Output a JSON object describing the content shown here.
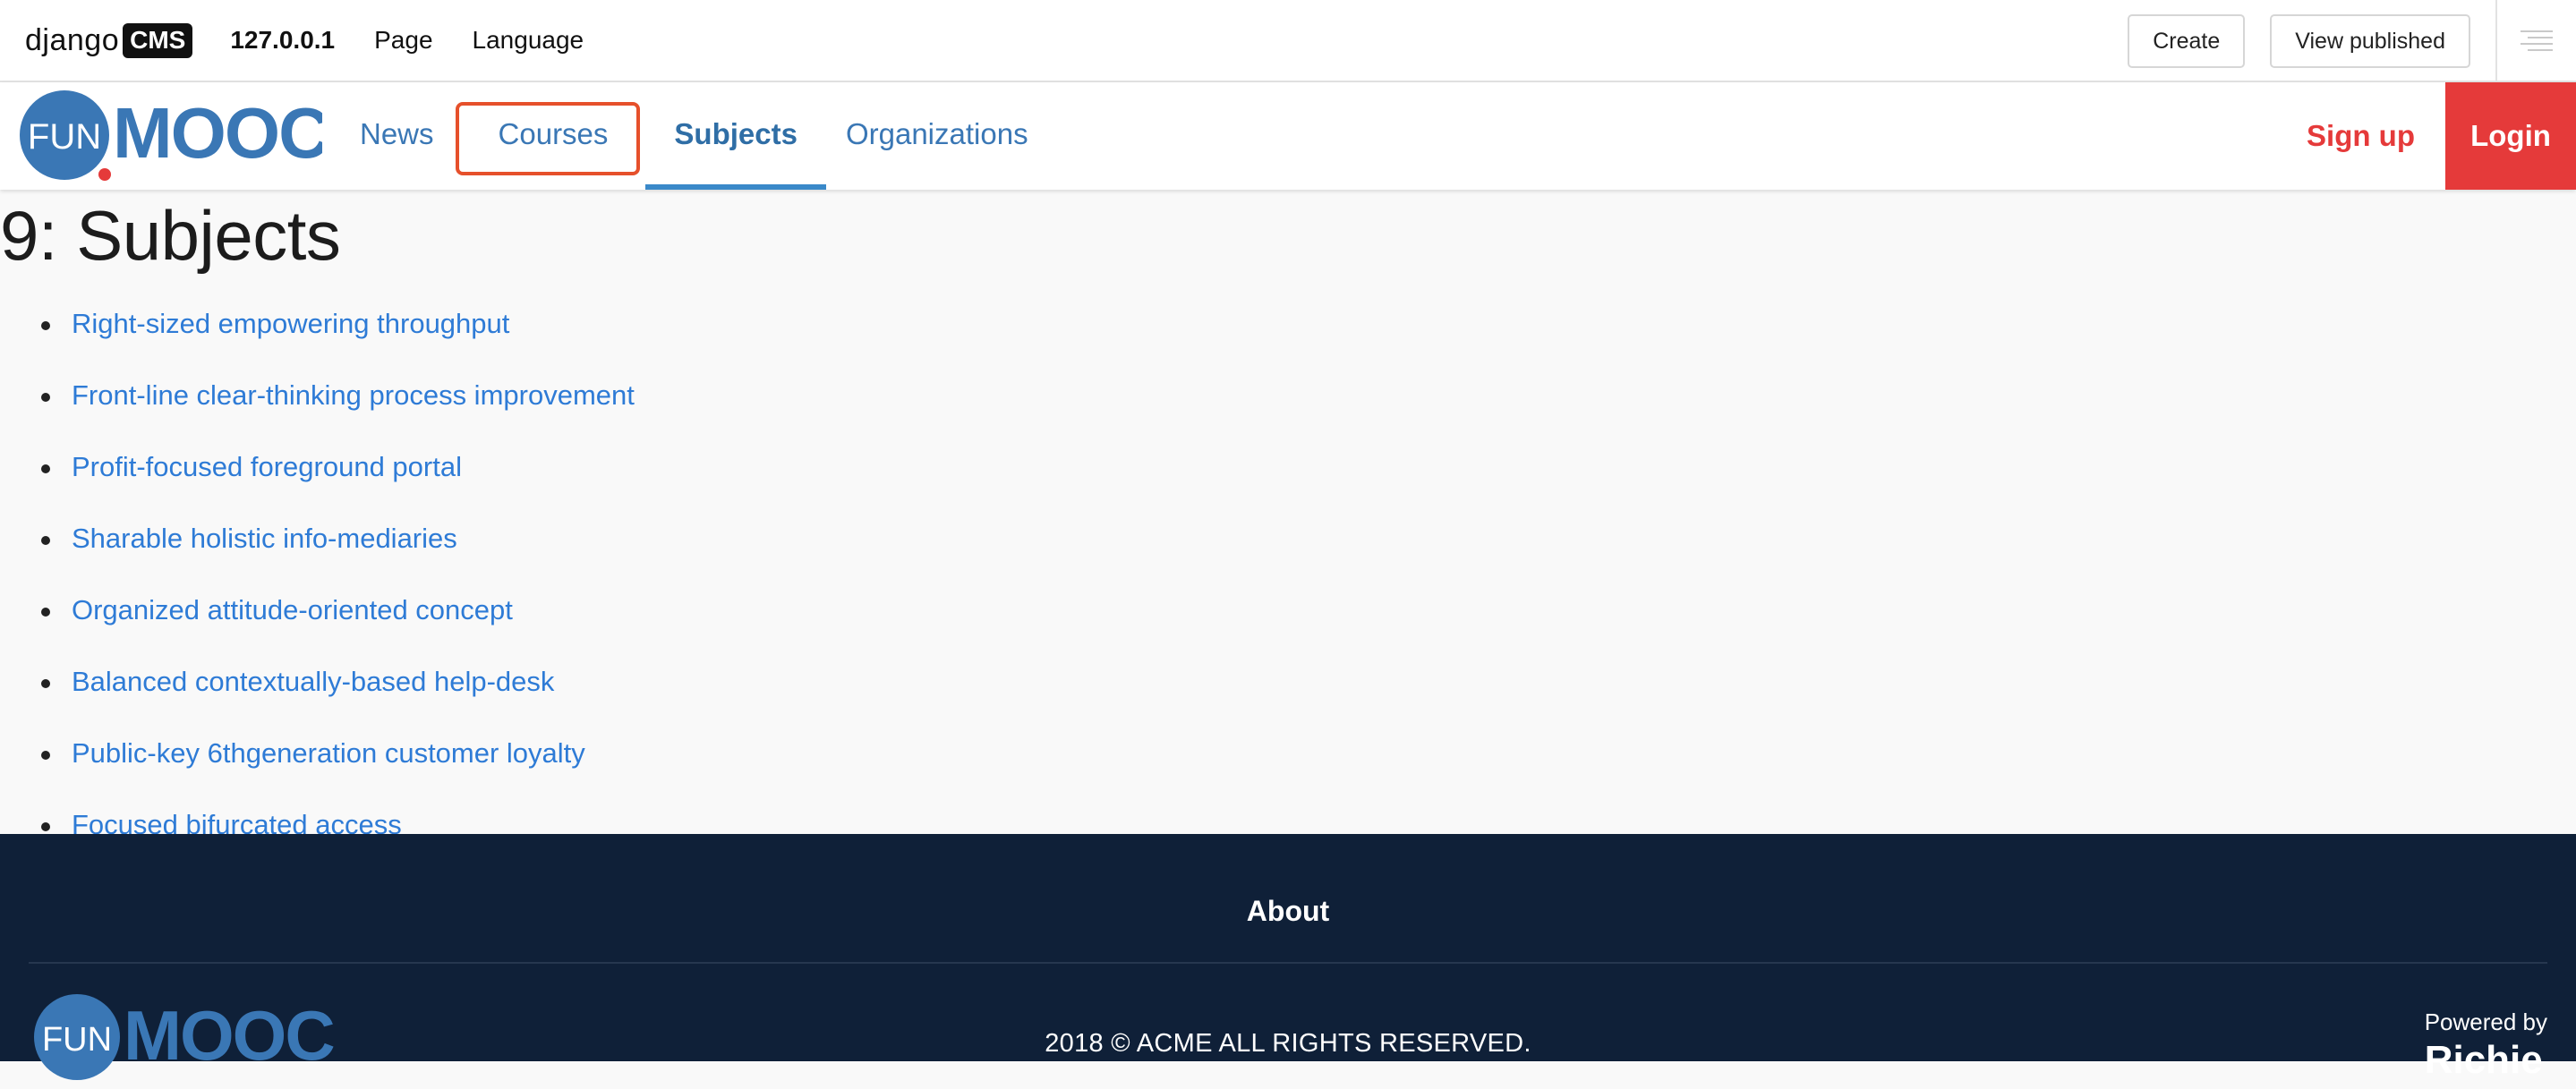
{
  "cms_toolbar": {
    "logo_text": "django",
    "logo_badge": "CMS",
    "menu": [
      {
        "label": "127.0.0.1"
      },
      {
        "label": "Page"
      },
      {
        "label": "Language"
      }
    ],
    "create_label": "Create",
    "view_published_label": "View published",
    "side_toggle_icon": "list-lines-icon"
  },
  "header": {
    "brand": {
      "fun": "FUN",
      "mooc": "MOOC"
    },
    "nav": [
      {
        "label": "News",
        "state": "normal"
      },
      {
        "label": "Courses",
        "state": "highlighted"
      },
      {
        "label": "Subjects",
        "state": "active"
      },
      {
        "label": "Organizations",
        "state": "normal"
      }
    ],
    "signup_label": "Sign up",
    "login_label": "Login"
  },
  "main": {
    "title": "9: Subjects",
    "subjects": [
      "Right-sized empowering throughput",
      "Front-line clear-thinking process improvement",
      "Profit-focused foreground portal",
      "Sharable holistic info-mediaries",
      "Organized attitude-oriented concept",
      "Balanced contextually-based help-desk",
      "Public-key 6thgeneration customer loyalty",
      "Focused bifurcated access"
    ]
  },
  "footer": {
    "about_label": "About",
    "copyright": "2018 © ACME ALL RIGHTS RESERVED.",
    "powered_by_label": "Powered by",
    "powered_by_brand": "Richie"
  },
  "colors": {
    "brand_blue": "#3a77b5",
    "link_blue": "#2e7bd6",
    "login_red": "#e53a3a",
    "highlight_orange": "#e6502b",
    "footer_navy": "#0f2038"
  }
}
